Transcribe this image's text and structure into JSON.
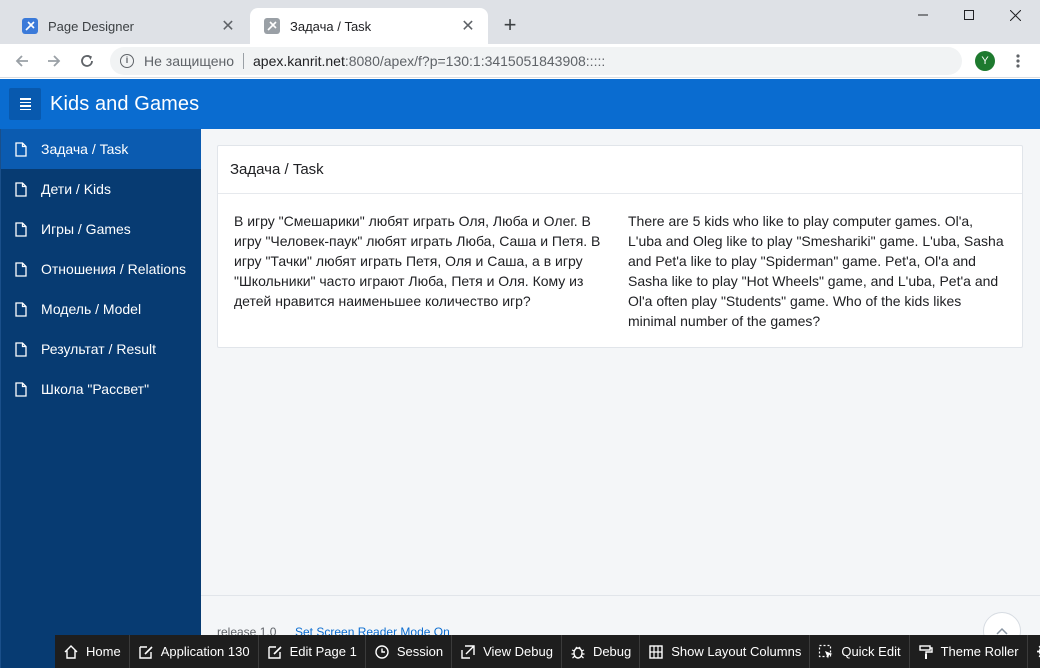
{
  "browser": {
    "tabs": [
      {
        "title": "Page Designer"
      },
      {
        "title": "Задача / Task"
      }
    ],
    "new_tab": "+",
    "address": {
      "security": "Не защищено",
      "host": "apex.kanrit.net",
      "path": ":8080/apex/f?p=130:1:3415051843908:::::"
    },
    "profile_initial": "Y"
  },
  "app": {
    "title": "Kids and Games"
  },
  "sidebar": {
    "items": [
      {
        "label": "Задача / Task",
        "active": true
      },
      {
        "label": "Дети / Kids"
      },
      {
        "label": "Игры / Games"
      },
      {
        "label": "Отношения / Relations"
      },
      {
        "label": "Модель / Model"
      },
      {
        "label": "Результат / Result"
      },
      {
        "label": "Школа \"Рассвет\""
      }
    ]
  },
  "region": {
    "title": "Задача / Task",
    "text_ru": "В игру \"Смешарики\" любят играть Оля, Люба и Олег. В игру \"Человек-паук\" любят играть Люба, Саша и Петя. В игру \"Тачки\" любят играть Петя, Оля и Саша, а в игру \"Школьники\" часто играют Люба, Петя и Оля. Кому из детей нравится наименьшее количество игр?",
    "text_en": "There are 5 kids who like to play computer games. Ol'a, L'uba and Oleg like to play \"Smeshariki\" game. L'uba, Sasha and Pet'a like to play \"Spiderman\" game. Pet'a, Ol'a and Sasha like to play \"Hot Wheels\" game, and L'uba, Pet'a and Ol'a often play \"Students\" game. Who of the kids likes minimal number of the games?"
  },
  "footer": {
    "release": "release 1.0",
    "screen_reader": "Set Screen Reader Mode On"
  },
  "devbar": {
    "home": "Home",
    "application": "Application 130",
    "edit_page": "Edit Page 1",
    "session": "Session",
    "view_debug": "View Debug",
    "debug": "Debug",
    "layout_columns": "Show Layout Columns",
    "quick_edit": "Quick Edit",
    "theme_roller": "Theme Roller"
  },
  "colors": {
    "header": "#0a6cd0",
    "sidebar": "#073b72",
    "sidebar_active": "#0b5bb0",
    "content_bg": "#f4f6f8",
    "devbar": "#1e1e1e"
  }
}
